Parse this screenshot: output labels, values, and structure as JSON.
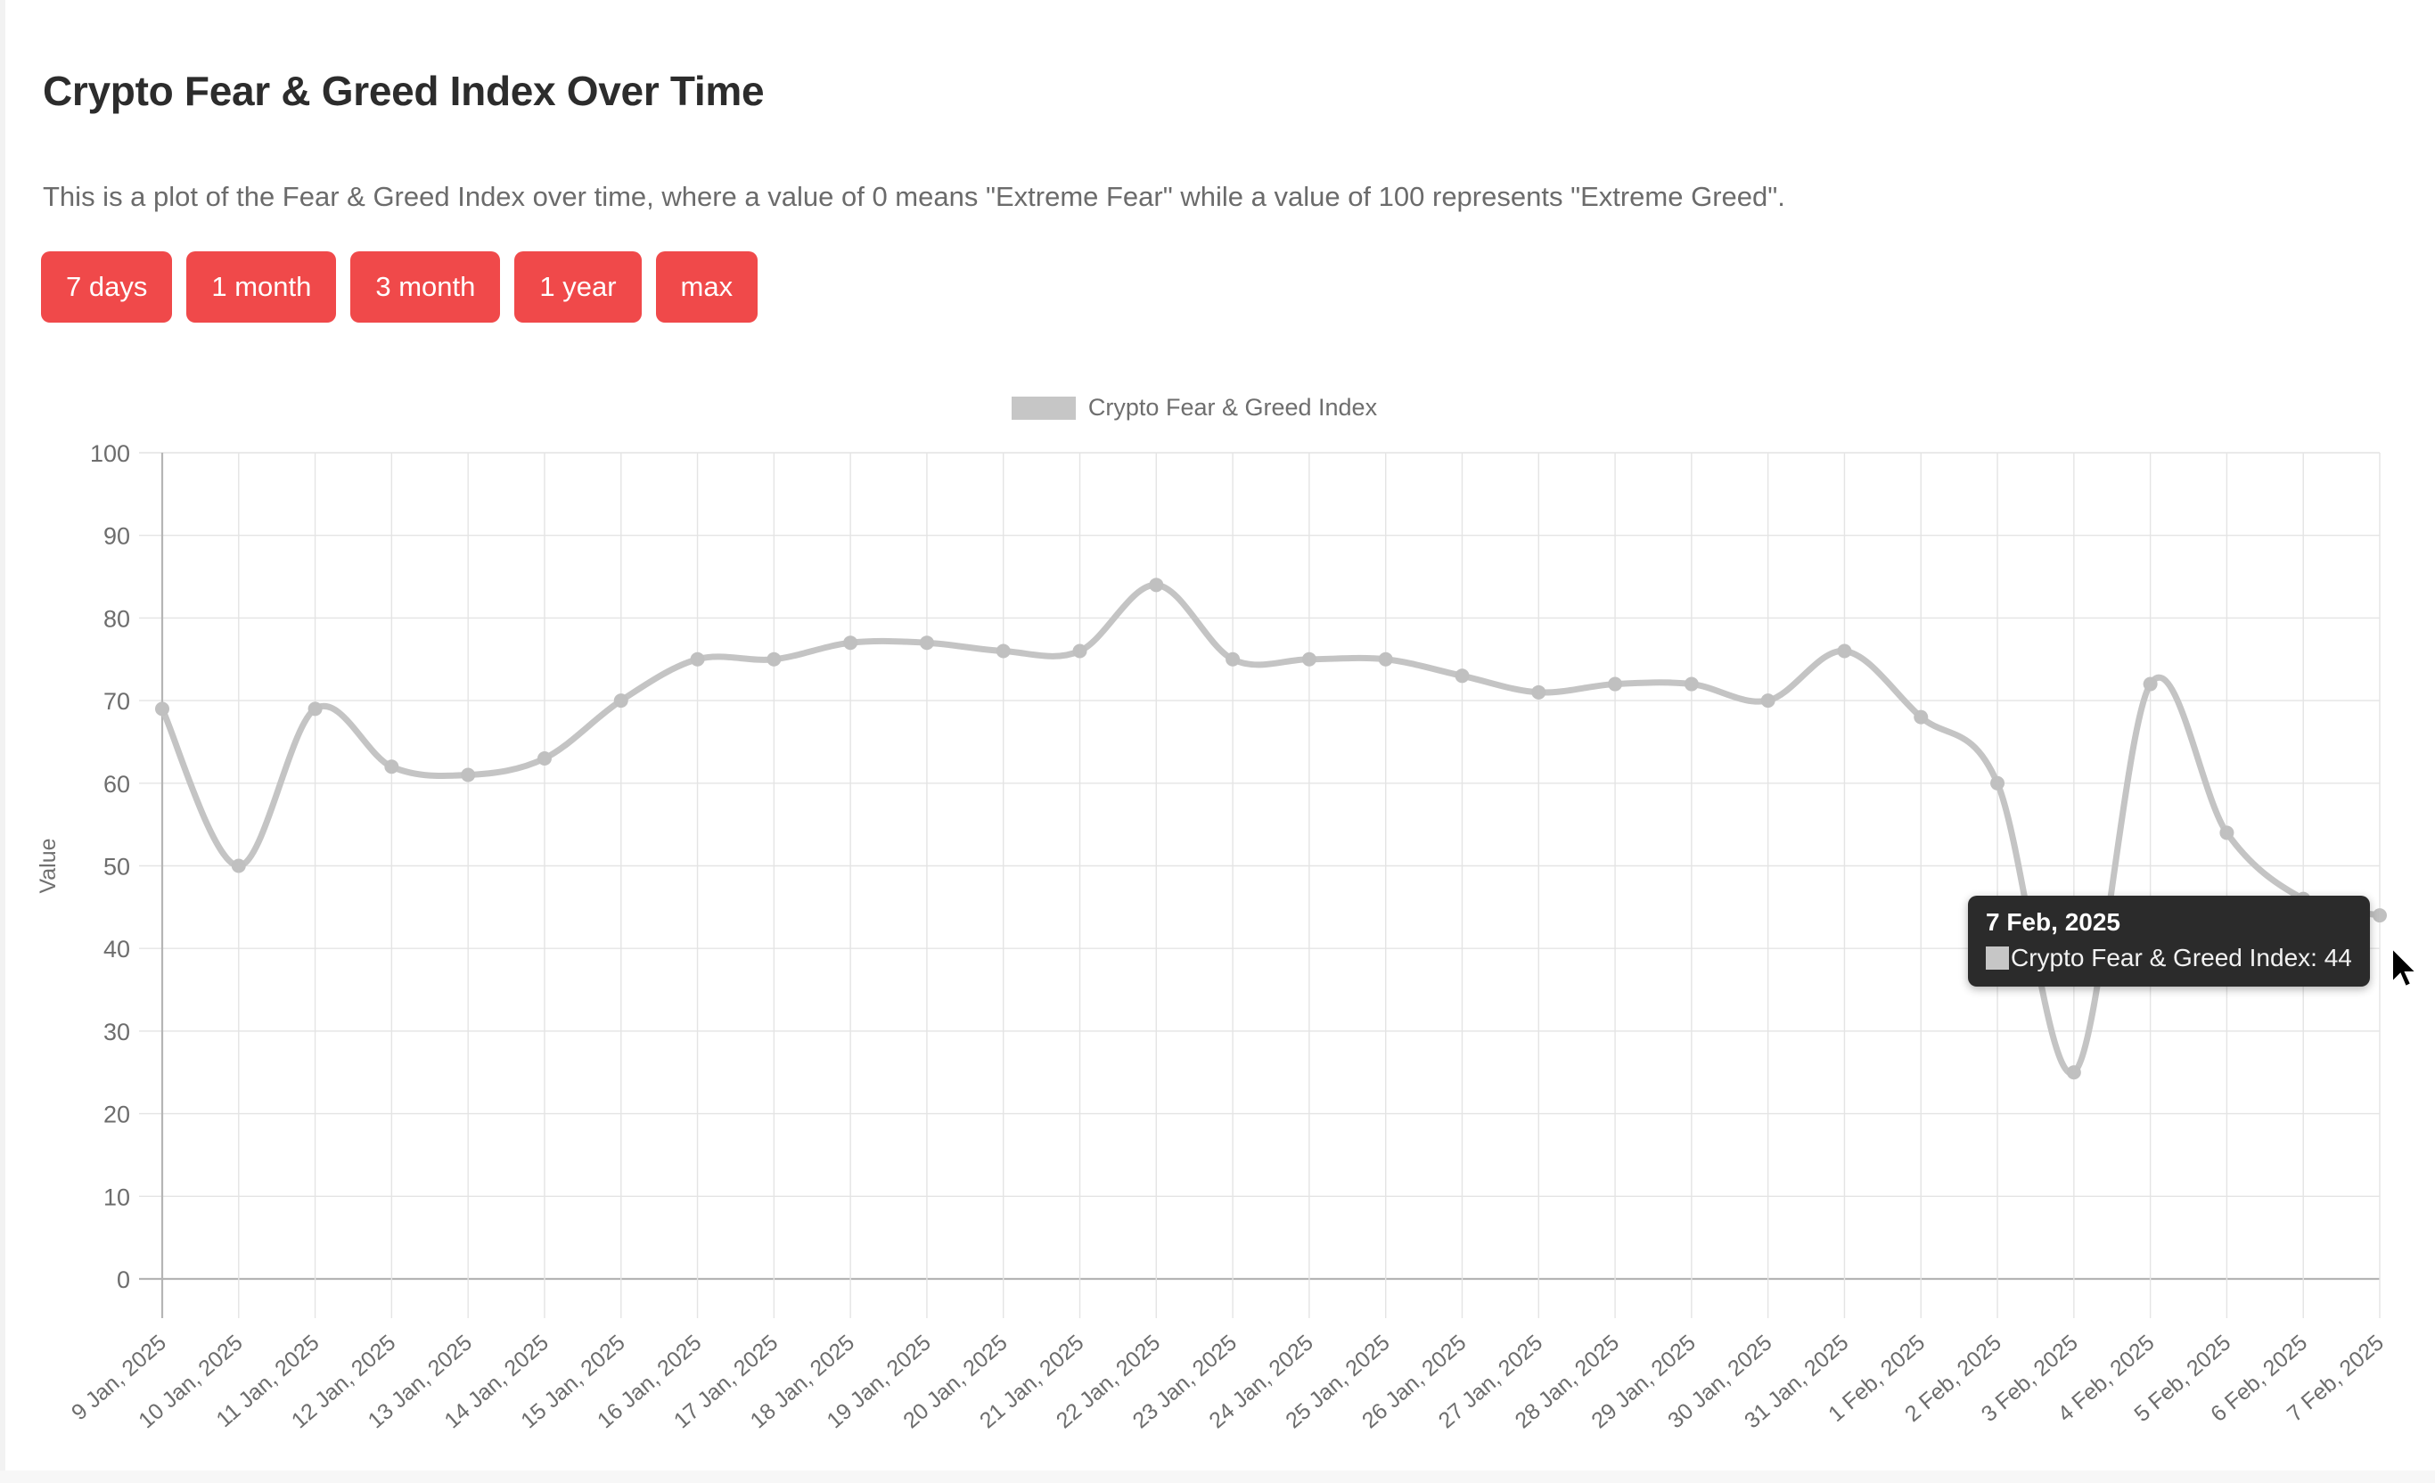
{
  "header": {
    "title": "Crypto Fear & Greed Index Over Time",
    "description": "This is a plot of the Fear & Greed Index over time, where a value of 0 means \"Extreme Fear\" while a value of 100 represents \"Extreme Greed\"."
  },
  "range_buttons": [
    {
      "label": "7 days"
    },
    {
      "label": "1 month"
    },
    {
      "label": "3 month"
    },
    {
      "label": "1 year"
    },
    {
      "label": "max"
    }
  ],
  "tooltip": {
    "date": "7 Feb, 2025",
    "series_text": "Crypto Fear & Greed Index: 44"
  },
  "colors": {
    "button": "#f0494a",
    "series": "#c4c4c4",
    "tooltip_bg": "#2b2b2b",
    "grid": "#e4e4e4"
  },
  "chart_data": {
    "type": "line",
    "title": "",
    "xlabel": "",
    "ylabel": "Value",
    "ylim": [
      0,
      100
    ],
    "yticks": [
      0,
      10,
      20,
      30,
      40,
      50,
      60,
      70,
      80,
      90,
      100
    ],
    "grid": true,
    "legend_position": "top-center",
    "legend": [
      "Crypto Fear & Greed Index"
    ],
    "categories": [
      "9 Jan, 2025",
      "10 Jan, 2025",
      "11 Jan, 2025",
      "12 Jan, 2025",
      "13 Jan, 2025",
      "14 Jan, 2025",
      "15 Jan, 2025",
      "16 Jan, 2025",
      "17 Jan, 2025",
      "18 Jan, 2025",
      "19 Jan, 2025",
      "20 Jan, 2025",
      "21 Jan, 2025",
      "22 Jan, 2025",
      "23 Jan, 2025",
      "24 Jan, 2025",
      "25 Jan, 2025",
      "26 Jan, 2025",
      "27 Jan, 2025",
      "28 Jan, 2025",
      "29 Jan, 2025",
      "30 Jan, 2025",
      "31 Jan, 2025",
      "1 Feb, 2025",
      "2 Feb, 2025",
      "3 Feb, 2025",
      "4 Feb, 2025",
      "5 Feb, 2025",
      "6 Feb, 2025",
      "7 Feb, 2025"
    ],
    "series": [
      {
        "name": "Crypto Fear & Greed Index",
        "values": [
          69,
          50,
          69,
          62,
          61,
          63,
          70,
          75,
          75,
          77,
          77,
          76,
          76,
          84,
          75,
          75,
          75,
          73,
          71,
          72,
          72,
          70,
          76,
          68,
          60,
          25,
          72,
          54,
          46,
          44
        ]
      }
    ]
  }
}
